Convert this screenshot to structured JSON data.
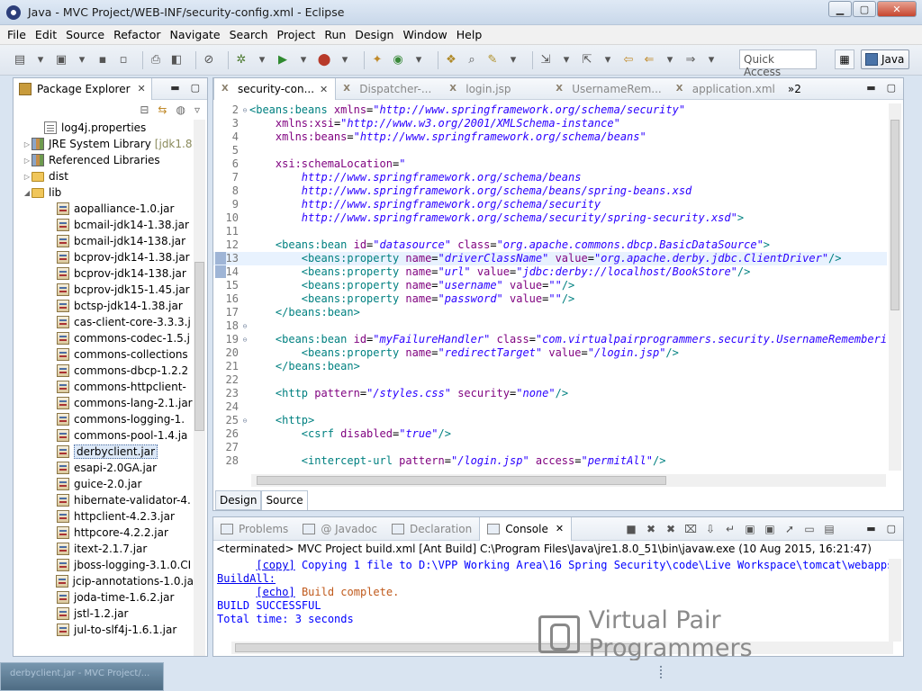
{
  "window": {
    "title": "Java - MVC Project/WEB-INF/security-config.xml - Eclipse"
  },
  "menu": [
    "File",
    "Edit",
    "Source",
    "Refactor",
    "Navigate",
    "Search",
    "Project",
    "Run",
    "Design",
    "Window",
    "Help"
  ],
  "toolbar": {
    "quick_access": "Quick Access",
    "perspective": "Java"
  },
  "package_explorer": {
    "title": "Package Explorer",
    "items": [
      {
        "label": "log4j.properties",
        "icon": "props",
        "indent": 2,
        "arrow": ""
      },
      {
        "label": "JRE System Library",
        "suffix": "[jdk1.8",
        "icon": "lib",
        "indent": 1,
        "arrow": "▷"
      },
      {
        "label": "Referenced Libraries",
        "icon": "lib",
        "indent": 1,
        "arrow": "▷"
      },
      {
        "label": "dist",
        "icon": "folder",
        "indent": 1,
        "arrow": "▷"
      },
      {
        "label": "lib",
        "icon": "folder",
        "indent": 1,
        "arrow": "◢"
      },
      {
        "label": "aopalliance-1.0.jar",
        "icon": "jar",
        "indent": 3
      },
      {
        "label": "bcmail-jdk14-1.38.jar",
        "icon": "jar",
        "indent": 3
      },
      {
        "label": "bcmail-jdk14-138.jar",
        "icon": "jar",
        "indent": 3
      },
      {
        "label": "bcprov-jdk14-1.38.jar",
        "icon": "jar",
        "indent": 3
      },
      {
        "label": "bcprov-jdk14-138.jar",
        "icon": "jar",
        "indent": 3
      },
      {
        "label": "bcprov-jdk15-1.45.jar",
        "icon": "jar",
        "indent": 3
      },
      {
        "label": "bctsp-jdk14-1.38.jar",
        "icon": "jar",
        "indent": 3
      },
      {
        "label": "cas-client-core-3.3.3.j",
        "icon": "jar",
        "indent": 3
      },
      {
        "label": "commons-codec-1.5.j",
        "icon": "jar",
        "indent": 3
      },
      {
        "label": "commons-collections",
        "icon": "jar",
        "indent": 3
      },
      {
        "label": "commons-dbcp-1.2.2",
        "icon": "jar",
        "indent": 3
      },
      {
        "label": "commons-httpclient-",
        "icon": "jar",
        "indent": 3
      },
      {
        "label": "commons-lang-2.1.jar",
        "icon": "jar",
        "indent": 3
      },
      {
        "label": "commons-logging-1.",
        "icon": "jar",
        "indent": 3
      },
      {
        "label": "commons-pool-1.4.ja",
        "icon": "jar",
        "indent": 3
      },
      {
        "label": "derbyclient.jar",
        "icon": "jar",
        "indent": 3,
        "selected": true
      },
      {
        "label": "esapi-2.0GA.jar",
        "icon": "jar",
        "indent": 3
      },
      {
        "label": "guice-2.0.jar",
        "icon": "jar",
        "indent": 3
      },
      {
        "label": "hibernate-validator-4.",
        "icon": "jar",
        "indent": 3
      },
      {
        "label": "httpclient-4.2.3.jar",
        "icon": "jar",
        "indent": 3
      },
      {
        "label": "httpcore-4.2.2.jar",
        "icon": "jar",
        "indent": 3
      },
      {
        "label": "itext-2.1.7.jar",
        "icon": "jar",
        "indent": 3
      },
      {
        "label": "jboss-logging-3.1.0.CI",
        "icon": "jar",
        "indent": 3
      },
      {
        "label": "jcip-annotations-1.0.ja",
        "icon": "jar",
        "indent": 3
      },
      {
        "label": "joda-time-1.6.2.jar",
        "icon": "jar",
        "indent": 3
      },
      {
        "label": "jstl-1.2.jar",
        "icon": "jar",
        "indent": 3
      },
      {
        "label": "jul-to-slf4j-1.6.1.jar",
        "icon": "jar",
        "indent": 3
      }
    ]
  },
  "editor": {
    "tabs": [
      {
        "label": "security-con...",
        "active": true
      },
      {
        "label": "Dispatcher-...",
        "active": false
      },
      {
        "label": "login.jsp",
        "active": false
      },
      {
        "label": "UsernameRem...",
        "active": false
      },
      {
        "label": "application.xml",
        "active": false
      }
    ],
    "overflow": "»2",
    "bottom_tabs": [
      "Design",
      "Source"
    ],
    "lines": [
      {
        "n": "2",
        "fold": "⊖",
        "hl": false,
        "t": [
          [
            "ct",
            "<beans:beans "
          ],
          [
            "ca",
            "xmlns"
          ],
          [
            "",
            "="
          ],
          [
            "cv",
            "\"http://www.springframework.org/schema/security\""
          ]
        ]
      },
      {
        "n": "3",
        "fold": "",
        "hl": false,
        "t": [
          [
            "",
            "    "
          ],
          [
            "ca",
            "xmlns:xsi"
          ],
          [
            "",
            "="
          ],
          [
            "cv",
            "\"http://www.w3.org/2001/XMLSchema-instance\""
          ]
        ]
      },
      {
        "n": "4",
        "fold": "",
        "hl": false,
        "t": [
          [
            "",
            "    "
          ],
          [
            "ca",
            "xmlns:beans"
          ],
          [
            "",
            "="
          ],
          [
            "cv",
            "\"http://www.springframework.org/schema/beans\""
          ]
        ]
      },
      {
        "n": "5",
        "fold": "",
        "hl": false,
        "t": []
      },
      {
        "n": "6",
        "fold": "",
        "hl": false,
        "t": [
          [
            "",
            "    "
          ],
          [
            "ca",
            "xsi:schemaLocation"
          ],
          [
            "",
            "="
          ],
          [
            "cv",
            "\""
          ]
        ]
      },
      {
        "n": "7",
        "fold": "",
        "hl": false,
        "t": [
          [
            "cv",
            "        http://www.springframework.org/schema/beans"
          ]
        ]
      },
      {
        "n": "8",
        "fold": "",
        "hl": false,
        "t": [
          [
            "cv",
            "        http://www.springframework.org/schema/beans/spring-beans.xsd"
          ]
        ]
      },
      {
        "n": "9",
        "fold": "",
        "hl": false,
        "t": [
          [
            "cv",
            "        http://www.springframework.org/schema/security"
          ]
        ]
      },
      {
        "n": "10",
        "fold": "",
        "hl": false,
        "t": [
          [
            "cv",
            "        http://www.springframework.org/schema/security/spring-security.xsd\""
          ],
          [
            "ct",
            ">"
          ]
        ]
      },
      {
        "n": "11",
        "fold": "",
        "hl": false,
        "t": []
      },
      {
        "n": "12",
        "fold": "",
        "hl": false,
        "t": [
          [
            "ct",
            "    <beans:bean "
          ],
          [
            "ca",
            "id"
          ],
          [
            "",
            "="
          ],
          [
            "cv",
            "\"datasource\""
          ],
          [
            "ca",
            " class"
          ],
          [
            "",
            "="
          ],
          [
            "cv",
            "\"org.apache.commons.dbcp.BasicDataSource\""
          ],
          [
            "ct",
            ">"
          ]
        ]
      },
      {
        "n": "13",
        "fold": "",
        "hl": true,
        "t": [
          [
            "ct",
            "        <beans:property "
          ],
          [
            "ca",
            "name"
          ],
          [
            "",
            "="
          ],
          [
            "cv",
            "\"driverClassName\""
          ],
          [
            "ca",
            " value"
          ],
          [
            "",
            "="
          ],
          [
            "cv",
            "\"org.apache.derby.jdbc.ClientDriver\""
          ],
          [
            "ct",
            "/>"
          ]
        ]
      },
      {
        "n": "14",
        "fold": "",
        "hl": false,
        "t": [
          [
            "ct",
            "        <beans:property "
          ],
          [
            "ca",
            "name"
          ],
          [
            "",
            "="
          ],
          [
            "cv",
            "\"url\""
          ],
          [
            "ca",
            " value"
          ],
          [
            "",
            "="
          ],
          [
            "cv",
            "\"jdbc:derby://localhost/BookStore\""
          ],
          [
            "ct",
            "/>"
          ]
        ]
      },
      {
        "n": "15",
        "fold": "",
        "hl": false,
        "t": [
          [
            "ct",
            "        <beans:property "
          ],
          [
            "ca",
            "name"
          ],
          [
            "",
            "="
          ],
          [
            "cv",
            "\"username\""
          ],
          [
            "ca",
            " value"
          ],
          [
            "",
            "="
          ],
          [
            "cv",
            "\"\""
          ],
          [
            "ct",
            "/>"
          ]
        ]
      },
      {
        "n": "16",
        "fold": "",
        "hl": false,
        "t": [
          [
            "ct",
            "        <beans:property "
          ],
          [
            "ca",
            "name"
          ],
          [
            "",
            "="
          ],
          [
            "cv",
            "\"password\""
          ],
          [
            "ca",
            " value"
          ],
          [
            "",
            "="
          ],
          [
            "cv",
            "\"\""
          ],
          [
            "ct",
            "/>"
          ]
        ]
      },
      {
        "n": "17",
        "fold": "",
        "hl": false,
        "t": [
          [
            "ct",
            "    </beans:bean>"
          ]
        ]
      },
      {
        "n": "18",
        "fold": "⊖",
        "hl": false,
        "t": []
      },
      {
        "n": "19",
        "fold": "⊖",
        "hl": false,
        "t": [
          [
            "ct",
            "    <beans:bean "
          ],
          [
            "ca",
            "id"
          ],
          [
            "",
            "="
          ],
          [
            "cv",
            "\"myFailureHandler\""
          ],
          [
            "ca",
            " class"
          ],
          [
            "",
            "="
          ],
          [
            "cv",
            "\"com.virtualpairprogrammers.security.UsernameRememberingA"
          ]
        ]
      },
      {
        "n": "20",
        "fold": "",
        "hl": false,
        "t": [
          [
            "ct",
            "        <beans:property "
          ],
          [
            "ca",
            "name"
          ],
          [
            "",
            "="
          ],
          [
            "cv",
            "\"redirectTarget\""
          ],
          [
            "ca",
            " value"
          ],
          [
            "",
            "="
          ],
          [
            "cv",
            "\"/login.jsp\""
          ],
          [
            "ct",
            "/>"
          ]
        ]
      },
      {
        "n": "21",
        "fold": "",
        "hl": false,
        "t": [
          [
            "ct",
            "    </beans:bean>"
          ]
        ]
      },
      {
        "n": "22",
        "fold": "",
        "hl": false,
        "t": []
      },
      {
        "n": "23",
        "fold": "",
        "hl": false,
        "t": [
          [
            "ct",
            "    <http "
          ],
          [
            "ca",
            "pattern"
          ],
          [
            "",
            "="
          ],
          [
            "cv",
            "\"/styles.css\""
          ],
          [
            "ca",
            " security"
          ],
          [
            "",
            "="
          ],
          [
            "cv",
            "\"none\""
          ],
          [
            "ct",
            "/>"
          ]
        ]
      },
      {
        "n": "24",
        "fold": "",
        "hl": false,
        "t": []
      },
      {
        "n": "25",
        "fold": "⊖",
        "hl": false,
        "t": [
          [
            "ct",
            "    <http>"
          ]
        ]
      },
      {
        "n": "26",
        "fold": "",
        "hl": false,
        "t": [
          [
            "ct",
            "        <csrf "
          ],
          [
            "ca",
            "disabled"
          ],
          [
            "",
            "="
          ],
          [
            "cv",
            "\"true\""
          ],
          [
            "ct",
            "/>"
          ]
        ]
      },
      {
        "n": "27",
        "fold": "",
        "hl": false,
        "t": []
      },
      {
        "n": "28",
        "fold": "",
        "hl": false,
        "t": [
          [
            "ct",
            "        <intercept-url "
          ],
          [
            "ca",
            "pattern"
          ],
          [
            "",
            "="
          ],
          [
            "cv",
            "\"/login.jsp\""
          ],
          [
            "ca",
            " access"
          ],
          [
            "",
            "="
          ],
          [
            "cv",
            "\"permitAll\""
          ],
          [
            "ct",
            "/>"
          ]
        ]
      }
    ]
  },
  "console": {
    "tabs": [
      {
        "label": "Problems",
        "active": false
      },
      {
        "label": "@ Javadoc",
        "active": false
      },
      {
        "label": "Declaration",
        "active": false
      },
      {
        "label": "Console",
        "active": true
      }
    ],
    "terminated": "<terminated> MVC Project build.xml [Ant Build] C:\\Program Files\\Java\\jre1.8.0_51\\bin\\javaw.exe (10 Aug 2015, 16:21:47)",
    "copy_tag": "[copy]",
    "copy_msg": " Copying 1 file to D:\\VPP Working Area\\16 Spring Security\\code\\Live Workspace\\tomcat\\webapps",
    "buildall": "BuildAll:",
    "echo_tag": "[echo]",
    "echo_msg": " Build complete.",
    "success": "BUILD SUCCESSFUL",
    "total": "Total time: 3 seconds"
  },
  "watermark": "Virtual Pair Programmers",
  "taskbar": {
    "thumb": "derbyclient.jar - MVC Project/..."
  }
}
